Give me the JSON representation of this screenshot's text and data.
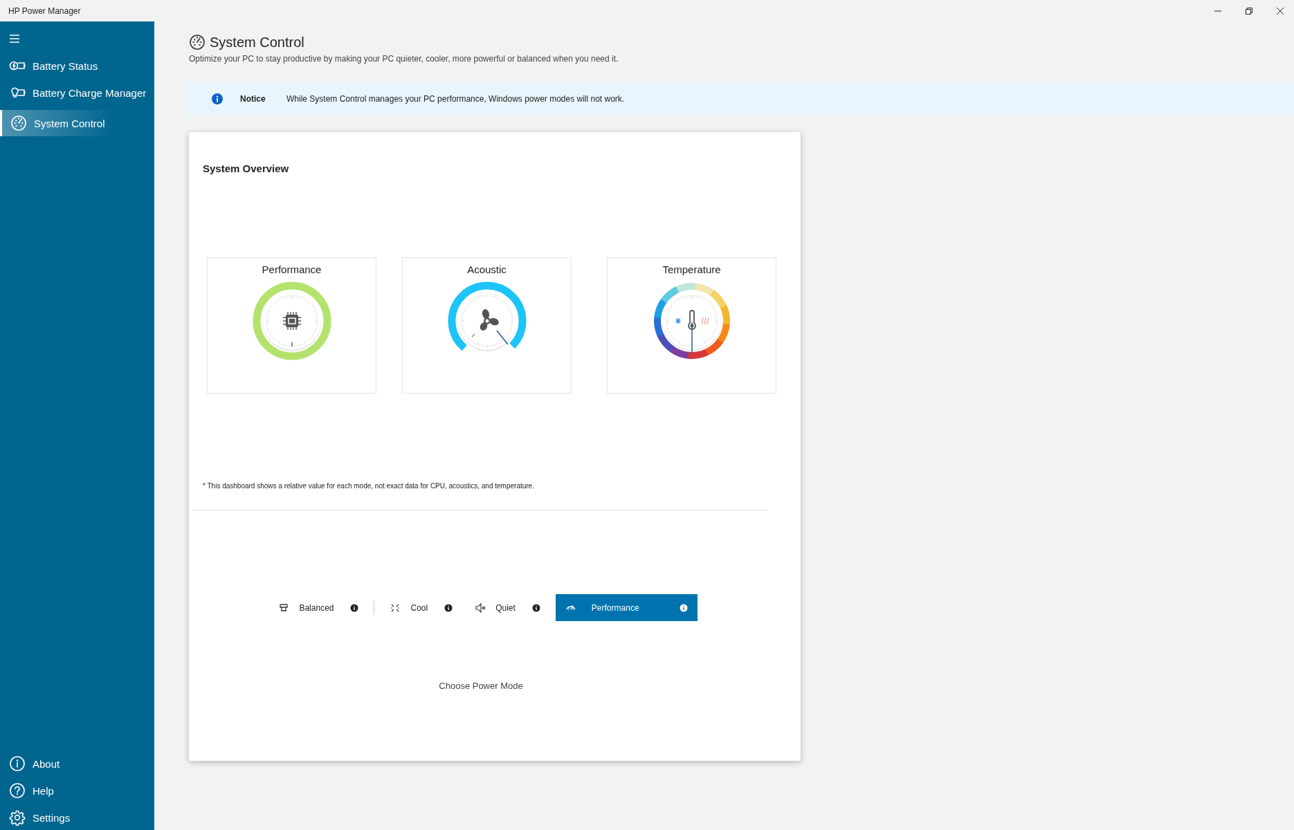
{
  "window": {
    "title": "HP Power Manager"
  },
  "sidebar": {
    "items": [
      {
        "label": "Battery Status",
        "kind": "battery-status",
        "selected": false
      },
      {
        "label": "Battery Charge Manager",
        "kind": "charge-manager",
        "selected": false
      },
      {
        "label": "System Control",
        "kind": "system-control",
        "selected": true
      }
    ],
    "footer_items": [
      {
        "label": "About",
        "kind": "about"
      },
      {
        "label": "Help",
        "kind": "help"
      },
      {
        "label": "Settings",
        "kind": "settings"
      }
    ]
  },
  "header": {
    "title": "System Control",
    "subtitle": "Optimize your PC to stay productive by making your PC quieter, cooler, more powerful or balanced when you need it."
  },
  "notice": {
    "label": "Notice",
    "text": "While System Control manages your PC performance, Windows power modes will not work."
  },
  "overview": {
    "title": "System Overview",
    "gauges": [
      {
        "label": "Performance",
        "kind": "performance"
      },
      {
        "label": "Acoustic",
        "kind": "acoustic"
      },
      {
        "label": "Temperature",
        "kind": "temperature"
      }
    ],
    "footnote": "* This dashboard shows a relative value for each mode, not exact data for CPU, acoustics, and temperature.",
    "modes": [
      {
        "label": "Balanced",
        "kind": "balanced",
        "selected": false
      },
      {
        "label": "Cool",
        "kind": "cool",
        "selected": false
      },
      {
        "label": "Quiet",
        "kind": "quiet",
        "selected": false
      },
      {
        "label": "Performance",
        "kind": "performance",
        "selected": true
      }
    ],
    "caption": "Choose Power Mode"
  }
}
